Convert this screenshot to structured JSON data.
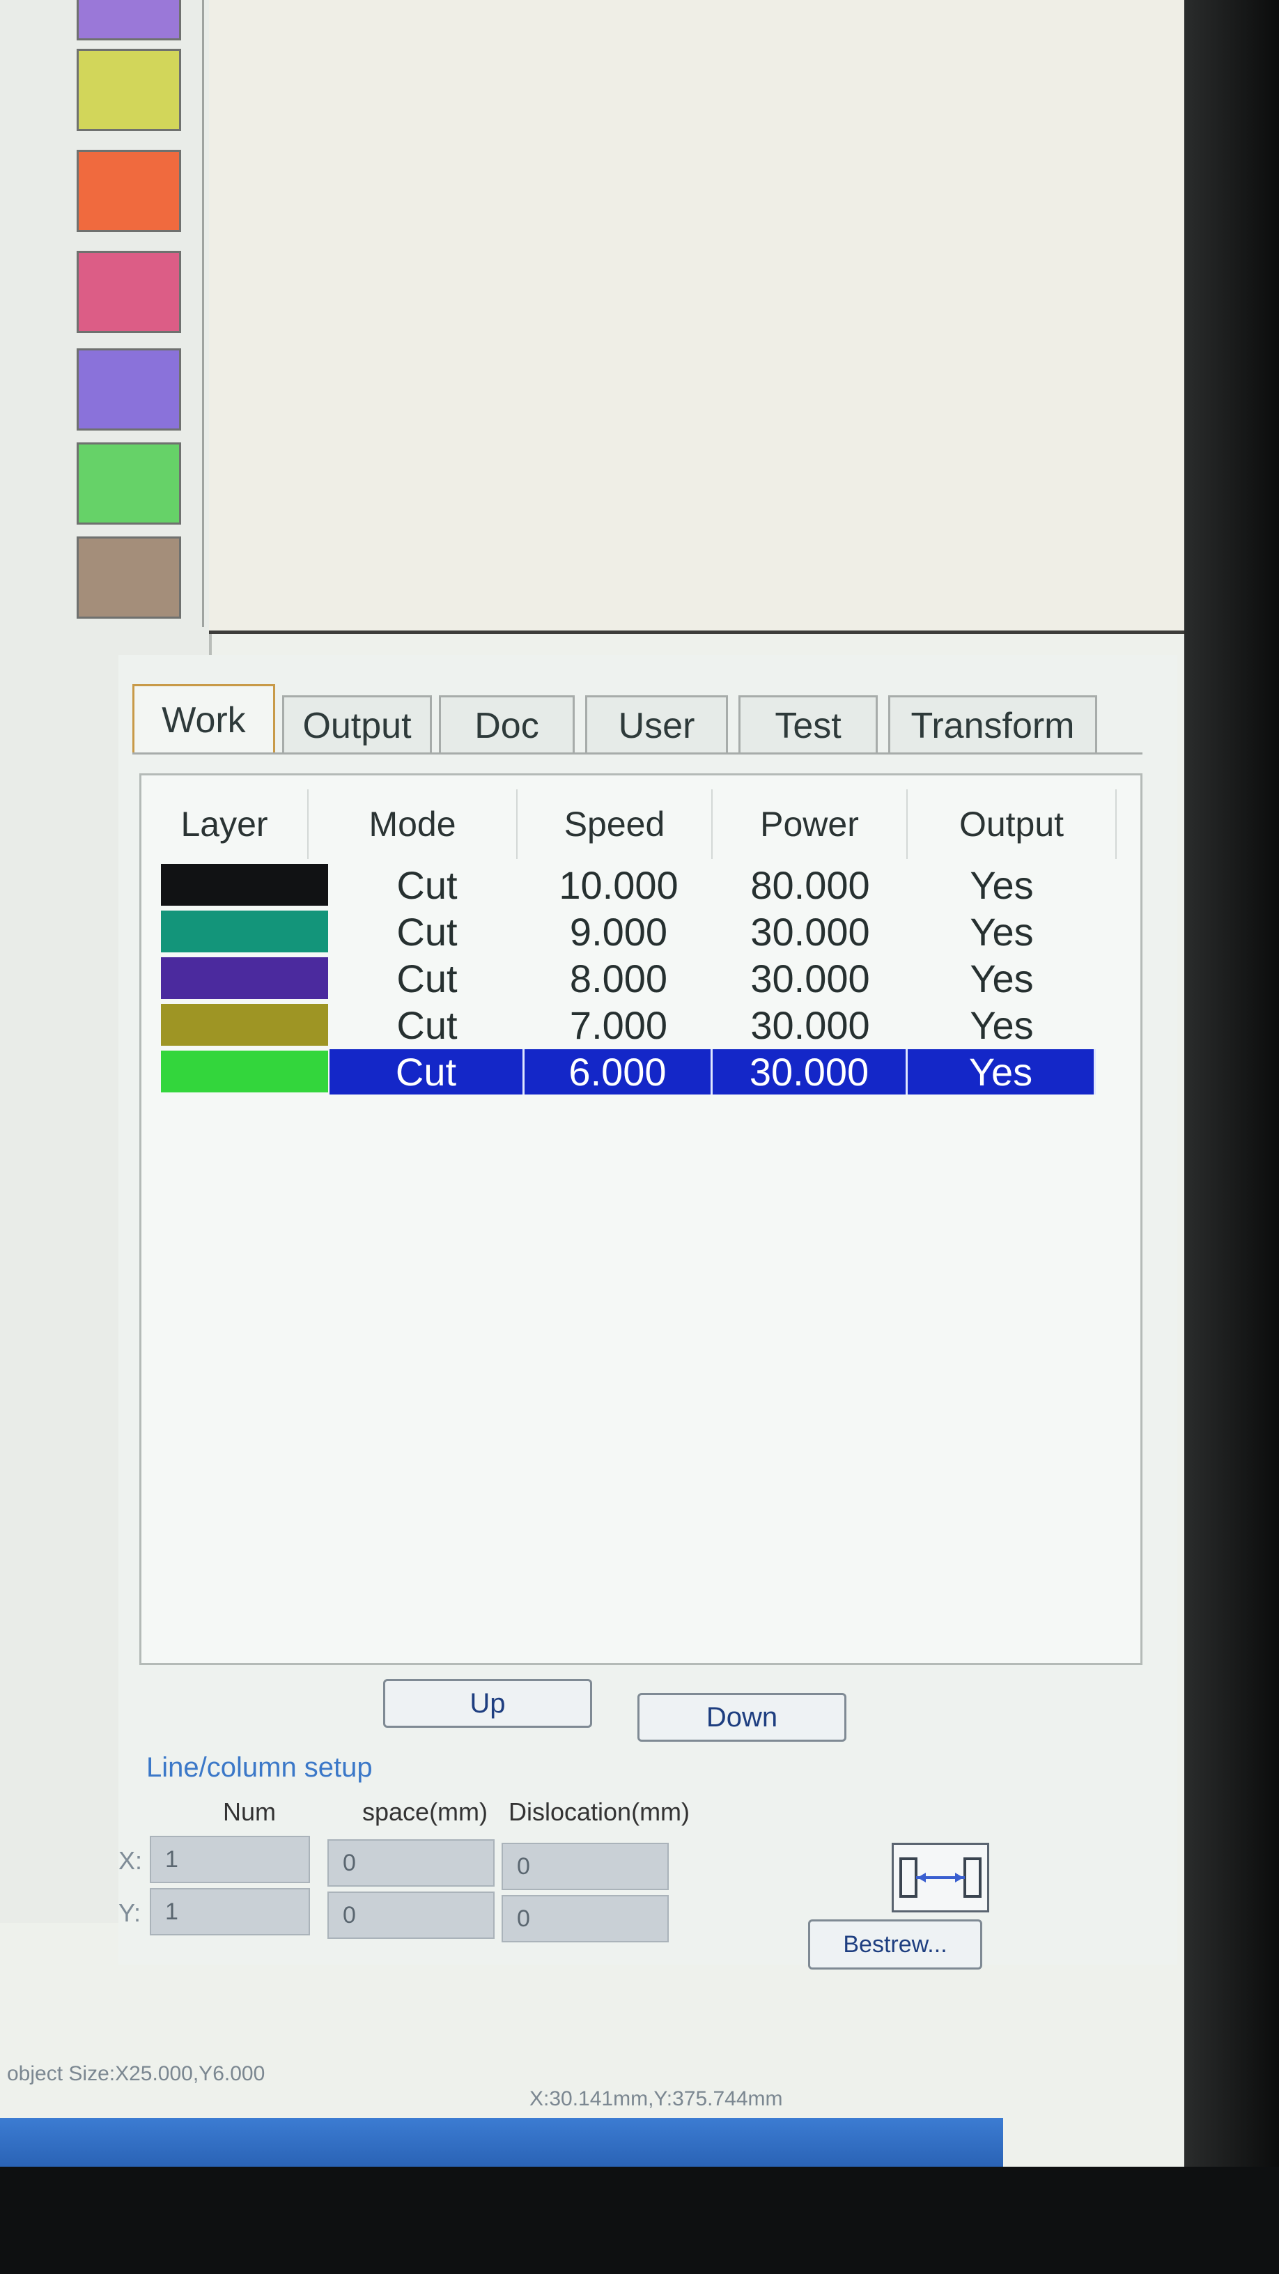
{
  "palette": {
    "colors": [
      "#9a78d8",
      "#d2d65a",
      "#f06a3e",
      "#dc5d86",
      "#8a72da",
      "#66d268",
      "#a48e7a"
    ]
  },
  "tabs": [
    {
      "label": "Work",
      "active": true
    },
    {
      "label": "Output",
      "active": false
    },
    {
      "label": "Doc",
      "active": false
    },
    {
      "label": "User",
      "active": false
    },
    {
      "label": "Test",
      "active": false
    },
    {
      "label": "Transform",
      "active": false
    }
  ],
  "layer_table": {
    "headers": {
      "layer": "Layer",
      "mode": "Mode",
      "speed": "Speed",
      "power": "Power",
      "output": "Output"
    },
    "rows": [
      {
        "color": "#111214",
        "mode": "Cut",
        "speed": "10.000",
        "power": "80.000",
        "output": "Yes",
        "selected": false
      },
      {
        "color": "#13957a",
        "mode": "Cut",
        "speed": "9.000",
        "power": "30.000",
        "output": "Yes",
        "selected": false
      },
      {
        "color": "#4b2a9e",
        "mode": "Cut",
        "speed": "8.000",
        "power": "30.000",
        "output": "Yes",
        "selected": false
      },
      {
        "color": "#9e9524",
        "mode": "Cut",
        "speed": "7.000",
        "power": "30.000",
        "output": "Yes",
        "selected": false
      },
      {
        "color": "#33d63c",
        "mode": "Cut",
        "speed": "6.000",
        "power": "30.000",
        "output": "Yes",
        "selected": true
      }
    ]
  },
  "buttons": {
    "up": "Up",
    "down": "Down",
    "bestrew": "Bestrew..."
  },
  "line_column_setup": {
    "title": "Line/column setup",
    "col_num": "Num",
    "col_space": "space(mm)",
    "col_dislocation": "Dislocation(mm)",
    "x_label": "X:",
    "y_label": "Y:",
    "x": {
      "num": "1",
      "space": "0",
      "dislocation": "0"
    },
    "y": {
      "num": "1",
      "space": "0",
      "dislocation": "0"
    }
  },
  "status": {
    "object_size": "object Size:X25.000,Y6.000",
    "coords": "X:30.141mm,Y:375.744mm"
  }
}
